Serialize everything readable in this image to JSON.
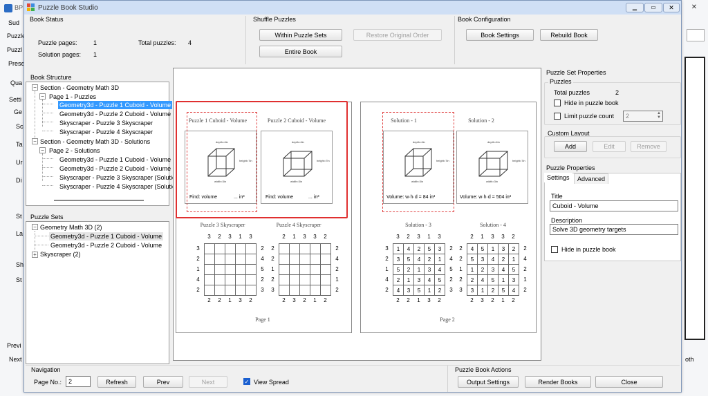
{
  "background_app": {
    "title": "BP",
    "left_fragments": [
      "Sud",
      "Puzzle",
      "Puzzl",
      "Prese",
      "Qua",
      "Setti",
      "Ge",
      "Sc",
      "Ta",
      "Ur",
      "Di",
      "St",
      "La",
      "Sh",
      "St",
      "Previ",
      "Next"
    ],
    "right_fragment": "oth"
  },
  "window": {
    "title": "Puzzle Book Studio"
  },
  "book_status": {
    "title": "Book Status",
    "puzzle_pages_label": "Puzzle pages:",
    "puzzle_pages": "1",
    "solution_pages_label": "Solution pages:",
    "solution_pages": "1",
    "total_puzzles_label": "Total puzzles:",
    "total_puzzles": "4"
  },
  "shuffle": {
    "title": "Shuffle Puzzles",
    "within_label": "Within Puzzle Sets",
    "restore_label": "Restore Original Order",
    "entire_label": "Entire Book"
  },
  "book_config": {
    "title": "Book Configuration",
    "settings_label": "Book Settings",
    "rebuild_label": "Rebuild Book"
  },
  "book_structure": {
    "title": "Book Structure",
    "items": [
      "Section - Geometry Math 3D",
      "Page 1 - Puzzles",
      "Geometry3d - Puzzle 1 Cuboid - Volume",
      "Geometry3d - Puzzle 2 Cuboid - Volume",
      "Skyscraper - Puzzle 3 Skyscraper",
      "Skyscraper - Puzzle 4 Skyscraper",
      "Section - Geometry Math 3D - Solutions",
      "Page 2 - Solutions",
      "Geometry3d - Puzzle 1 Cuboid - Volume (S",
      "Geometry3d - Puzzle 2 Cuboid - Volume (S",
      "Skyscraper - Puzzle 3 Skyscraper (Solutic",
      "Skyscraper - Puzzle 4 Skyscraper (Solutic"
    ]
  },
  "puzzle_sets": {
    "title": "Puzzle Sets",
    "items": [
      "Geometry Math 3D (2)",
      "Geometry3d - Puzzle 1 Cuboid - Volume",
      "Geometry3d - Puzzle 2 Cuboid - Volume",
      "Skyscraper (2)"
    ]
  },
  "preview": {
    "page1": {
      "puzzle1_title": "Puzzle 1 Cuboid - Volume",
      "puzzle2_title": "Puzzle 2 Cuboid - Volume",
      "find1": "Find: volume",
      "find1_unit": "... in³",
      "find2": "Find: volume",
      "find2_unit": "... in³",
      "puzzle3_title": "Puzzle 3 Skyscraper",
      "puzzle4_title": "Puzzle 4 Skyscraper",
      "footer": "Page 1"
    },
    "page2": {
      "sol1_title": "Solution - 1",
      "sol2_title": "Solution - 2",
      "sol1_answer": "Volume: w·h·d = 84 in³",
      "sol2_answer": "Volume: w·h·d = 504 in³",
      "sol3_title": "Solution - 3",
      "sol4_title": "Solution - 4",
      "footer": "Page 2"
    },
    "cube_labels": {
      "depth": "depth=4in",
      "height": "height=7in",
      "width": "width=3in"
    },
    "sky3": {
      "top": [
        "3",
        "2",
        "3",
        "1",
        "3"
      ],
      "bottom": [
        "2",
        "2",
        "1",
        "3",
        "2"
      ],
      "left": [
        "3",
        "2",
        "1",
        "4",
        "2"
      ],
      "right": [
        "2",
        "4",
        "5",
        "2",
        "3"
      ]
    },
    "sky4": {
      "top": [
        "2",
        "1",
        "3",
        "3",
        "2"
      ],
      "bottom": [
        "2",
        "3",
        "2",
        "1",
        "2"
      ],
      "left": [
        "2",
        "2",
        "1",
        "2",
        "3"
      ],
      "right": [
        "2",
        "4",
        "2",
        "1",
        "2"
      ]
    },
    "sol3": {
      "top": [
        "3",
        "2",
        "3",
        "1",
        "3"
      ],
      "bottom": [
        "2",
        "2",
        "1",
        "3",
        "2"
      ],
      "left": [
        "3",
        "2",
        "1",
        "4",
        "2"
      ],
      "right": [
        "2",
        "4",
        "5",
        "2",
        "3"
      ],
      "cells": [
        [
          "1",
          "4",
          "2",
          "5",
          "3"
        ],
        [
          "3",
          "5",
          "4",
          "2",
          "1"
        ],
        [
          "5",
          "2",
          "1",
          "3",
          "4"
        ],
        [
          "2",
          "1",
          "3",
          "4",
          "5"
        ],
        [
          "4",
          "3",
          "5",
          "1",
          "2"
        ]
      ]
    },
    "sol4": {
      "top": [
        "2",
        "1",
        "3",
        "3",
        "2"
      ],
      "bottom": [
        "2",
        "3",
        "2",
        "1",
        "2"
      ],
      "left": [
        "2",
        "2",
        "1",
        "2",
        "3"
      ],
      "right": [
        "2",
        "4",
        "2",
        "1",
        "2"
      ],
      "cells": [
        [
          "4",
          "5",
          "1",
          "3",
          "2"
        ],
        [
          "5",
          "3",
          "4",
          "2",
          "1"
        ],
        [
          "1",
          "2",
          "3",
          "4",
          "5"
        ],
        [
          "2",
          "4",
          "5",
          "1",
          "3"
        ],
        [
          "3",
          "1",
          "2",
          "5",
          "4"
        ]
      ]
    }
  },
  "puzzle_set_props": {
    "title": "Puzzle Set Properties",
    "puzzles_group": "Puzzles",
    "total_label": "Total puzzles",
    "total_value": "2",
    "hide_label": "Hide in puzzle book",
    "limit_label": "Limit puzzle count",
    "limit_value": "2",
    "custom_layout": "Custom Layout",
    "add_label": "Add",
    "edit_label": "Edit",
    "remove_label": "Remove"
  },
  "puzzle_props": {
    "title": "Puzzle Properties",
    "tab_settings": "Settings",
    "tab_advanced": "Advanced",
    "title_label": "Title",
    "title_value": "Cuboid - Volume",
    "desc_label": "Description",
    "desc_value": "Solve 3D geometry targets",
    "hide_label": "Hide in puzzle book"
  },
  "navigation": {
    "title": "Navigation",
    "page_no_label": "Page No.:",
    "page_no": "2",
    "refresh_label": "Refresh",
    "prev_label": "Prev",
    "next_label": "Next",
    "view_spread_label": "View Spread"
  },
  "actions": {
    "title": "Puzzle Book Actions",
    "output_label": "Output Settings",
    "render_label": "Render Books",
    "close_label": "Close"
  },
  "colors": {
    "accent": "#3399ff",
    "highlight": "#e03030",
    "title_bar": "#cfdff5"
  }
}
